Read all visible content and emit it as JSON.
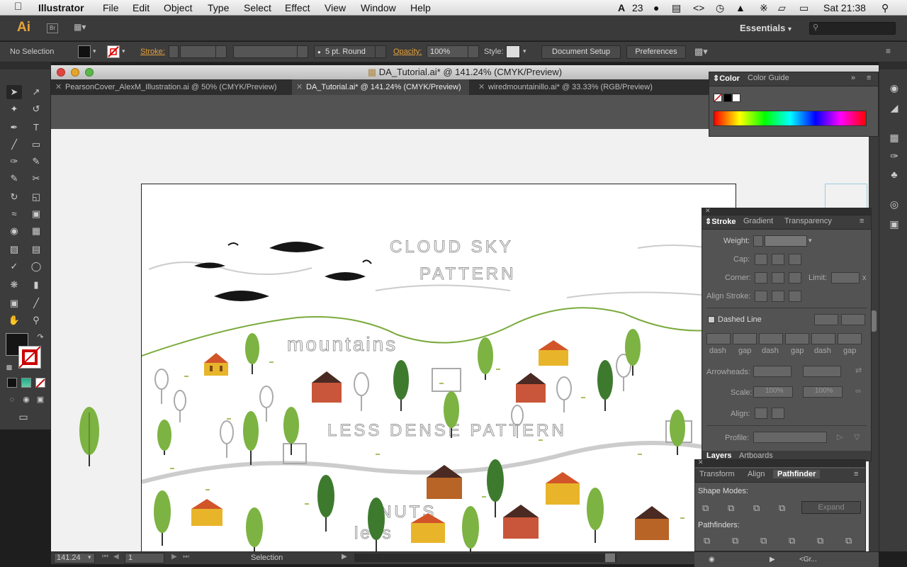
{
  "menubar": {
    "app_name": "Illustrator",
    "items": [
      "File",
      "Edit",
      "Object",
      "Type",
      "Select",
      "Effect",
      "View",
      "Window",
      "Help"
    ],
    "status_count": "23",
    "clock": "Sat 21:38"
  },
  "appbar": {
    "logo": "Ai",
    "bridge": "Br",
    "workspace": "Essentials",
    "search_placeholder": ""
  },
  "controlbar": {
    "selection": "No Selection",
    "stroke_label": "Stroke:",
    "brush": "5 pt. Round",
    "opacity_label": "Opacity:",
    "opacity_value": "100%",
    "style_label": "Style:",
    "document_setup": "Document Setup",
    "preferences": "Preferences"
  },
  "document": {
    "title": "DA_Tutorial.ai* @ 141.24% (CMYK/Preview)",
    "tabs": [
      {
        "label": "PearsonCover_AlexM_Illustration.ai @ 50% (CMYK/Preview)"
      },
      {
        "label": "DA_Tutorial.ai* @ 141.24% (CMYK/Preview)"
      },
      {
        "label": "wiredmountainillo.ai* @ 33.33% (RGB/Preview)"
      }
    ]
  },
  "artwork": {
    "sketch_text_1": "CLOUD SKY",
    "sketch_text_2": "PATTERN",
    "sketch_text_3": "mountains",
    "sketch_text_4": "LESS DENSE PATTERN",
    "sketch_text_5": "NUTS",
    "sketch_text_6": "less"
  },
  "status": {
    "zoom": "141.24",
    "page": "1",
    "tool": "Selection"
  },
  "color_panel": {
    "tabs": [
      "Color",
      "Color Guide"
    ]
  },
  "stroke_panel": {
    "tabs": [
      "Stroke",
      "Gradient",
      "Transparency"
    ],
    "weight": "Weight:",
    "cap": "Cap:",
    "corner": "Corner:",
    "limit": "Limit:",
    "limit_unit": "x",
    "align_stroke": "Align Stroke:",
    "dashed_line": "Dashed Line",
    "dash_labels": [
      "dash",
      "gap",
      "dash",
      "gap",
      "dash",
      "gap"
    ],
    "arrowheads": "Arrowheads:",
    "scale": "Scale:",
    "scale_value_1": "100%",
    "scale_value_2": "100%",
    "align": "Align:",
    "profile": "Profile:",
    "bottom_tabs": [
      "Layers",
      "Artboards"
    ]
  },
  "pathfinder_panel": {
    "tabs": [
      "Transform",
      "Align",
      "Pathfinder"
    ],
    "shape_modes": "Shape Modes:",
    "expand": "Expand",
    "pathfinders": "Pathfinders:"
  },
  "layers_row": {
    "label": "<Gr..."
  }
}
